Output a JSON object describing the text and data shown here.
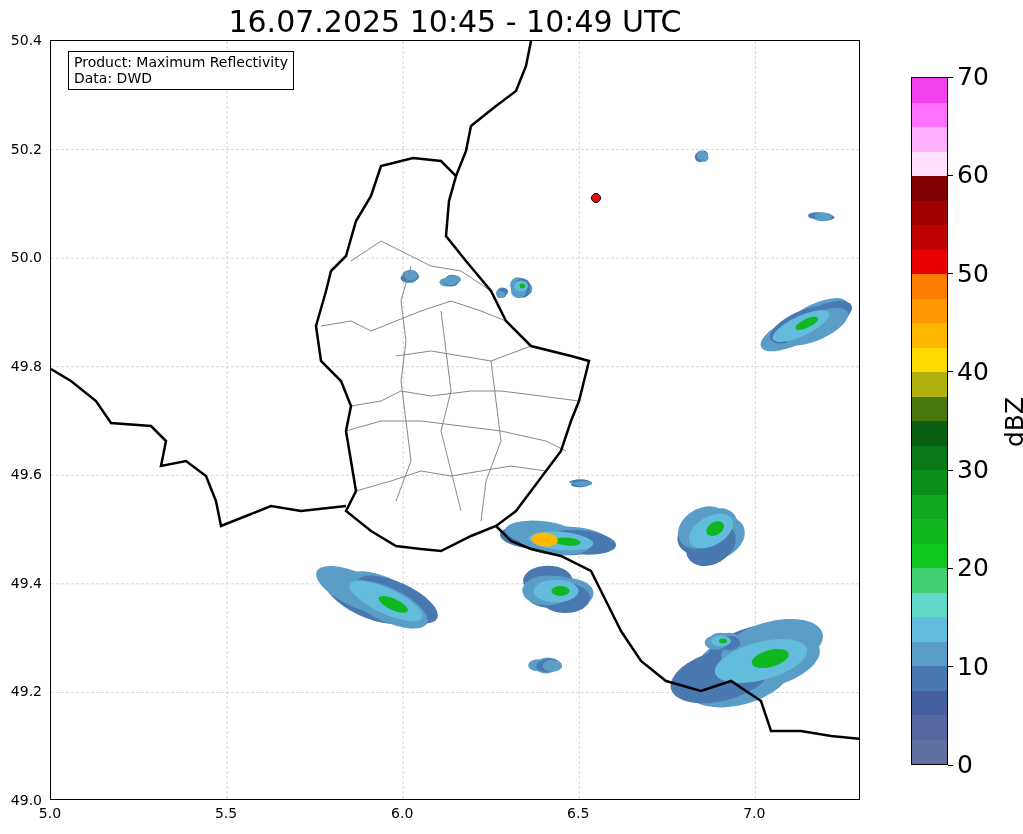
{
  "title": "16.07.2025 10:45 - 10:49 UTC",
  "info_box": {
    "lines": [
      "Product: Maximum Reflectivity",
      "Data: DWD"
    ]
  },
  "x_axis": {
    "ticks": [
      "5.0",
      "5.5",
      "6.0",
      "6.5",
      "7.0"
    ]
  },
  "y_axis": {
    "ticks": [
      "50.4",
      "50.2",
      "50.0",
      "49.8",
      "49.6",
      "49.4",
      "49.2",
      "49.0"
    ]
  },
  "colorbar": {
    "label": "dBZ",
    "ticks": [
      "70",
      "60",
      "50",
      "40",
      "30",
      "20",
      "10",
      "0"
    ],
    "segments": [
      {
        "color": "#6070a0"
      },
      {
        "color": "#5566a0"
      },
      {
        "color": "#4560a0"
      },
      {
        "color": "#4a78b0"
      },
      {
        "color": "#5a9ec8"
      },
      {
        "color": "#64bcdc"
      },
      {
        "color": "#60d8c8"
      },
      {
        "color": "#40d070"
      },
      {
        "color": "#10c820"
      },
      {
        "color": "#10b820"
      },
      {
        "color": "#10a820"
      },
      {
        "color": "#0a9018"
      },
      {
        "color": "#0a7818"
      },
      {
        "color": "#0a6010"
      },
      {
        "color": "#4a7810"
      },
      {
        "color": "#b0b010"
      },
      {
        "color": "#ffd800"
      },
      {
        "color": "#ffb800"
      },
      {
        "color": "#ff9800"
      },
      {
        "color": "#ff7c00"
      },
      {
        "color": "#e80000"
      },
      {
        "color": "#c00000"
      },
      {
        "color": "#a00000"
      },
      {
        "color": "#800000"
      },
      {
        "color": "#ffe0ff"
      },
      {
        "color": "#ffb0ff"
      },
      {
        "color": "#ff70ff"
      },
      {
        "color": "#f040f0"
      }
    ]
  }
}
